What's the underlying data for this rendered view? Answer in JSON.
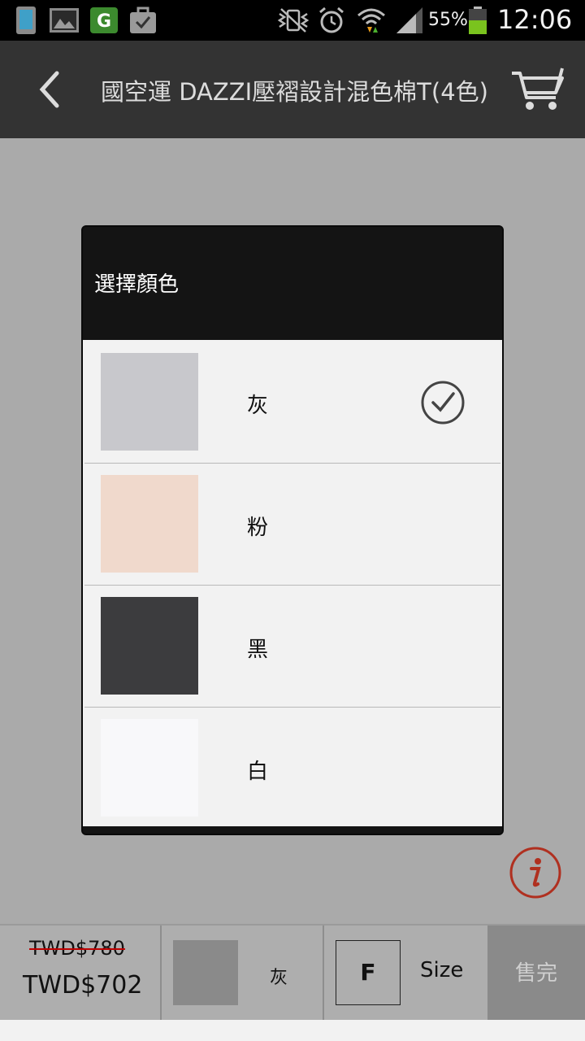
{
  "status_bar": {
    "battery": "55%",
    "time": "12:06",
    "icons": [
      "phone-icon",
      "gallery-icon",
      "g-app-icon",
      "briefcase-check-icon",
      "vibrate-icon",
      "alarm-icon",
      "wifi-icon",
      "signal-icon",
      "battery-icon"
    ]
  },
  "app_bar": {
    "title": "國空運 DAZZI壓褶設計混色棉T(4色)",
    "back_icon": "chevron-left-icon",
    "cart_icon": "cart-icon"
  },
  "dialog": {
    "title": "選擇顏色",
    "colors": [
      {
        "label": "灰",
        "swatch": "#c8c8cc",
        "selected": true
      },
      {
        "label": "粉",
        "swatch": "#f0d9cc",
        "selected": false
      },
      {
        "label": "黑",
        "swatch": "#3c3c3e",
        "selected": false
      },
      {
        "label": "白",
        "swatch": "#f8f8fa",
        "selected": false
      }
    ]
  },
  "bottom_bar": {
    "price_original": "TWD$780",
    "price_sale": "TWD$702",
    "selected_color": "灰",
    "size_value": "F",
    "size_label": "Size",
    "sold_out": "售完"
  },
  "accent_colors": {
    "strike": "#c00000",
    "info_icon": "#b03020"
  }
}
